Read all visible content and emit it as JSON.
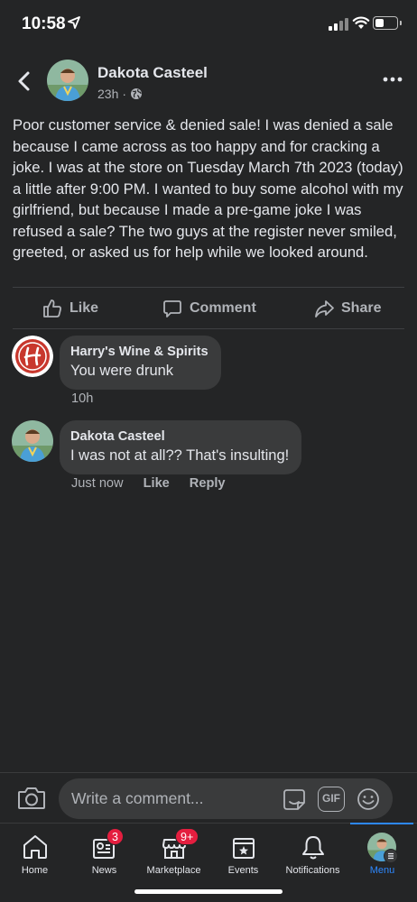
{
  "status_bar": {
    "time": "10:58"
  },
  "post": {
    "author": "Dakota Casteel",
    "time": "23h",
    "separator": "·",
    "body": "Poor customer service & denied sale! I was denied a sale because I came across as too happy and for cracking a joke. I was at the store on Tuesday March 7th 2023 (today) a little after 9:00 PM. I wanted to buy some alcohol with my girlfriend, but because I made a pre-game joke I was refused a sale? The two guys at the register never smiled, greeted, or asked us for help while we looked around."
  },
  "actions": {
    "like": "Like",
    "comment": "Comment",
    "share": "Share"
  },
  "comments": [
    {
      "author": "Harry's Wine & Spirits",
      "text": "You were drunk",
      "time": "10h"
    },
    {
      "author": "Dakota Casteel",
      "text": "I was not at all?? That's insulting!",
      "time": "Just now",
      "like": "Like",
      "reply": "Reply"
    }
  ],
  "comment_bar": {
    "placeholder": "Write a comment...",
    "gif_label": "GIF"
  },
  "tabs": [
    {
      "label": "Home"
    },
    {
      "label": "News",
      "badge": "3"
    },
    {
      "label": "Marketplace",
      "badge": "9+"
    },
    {
      "label": "Events"
    },
    {
      "label": "Notifications"
    },
    {
      "label": "Menu",
      "active": true
    }
  ],
  "colors": {
    "background": "#242526",
    "bubble": "#3a3b3c",
    "accent": "#2d88ff",
    "badge": "#e41e3f",
    "brand_red": "#c8372d"
  }
}
